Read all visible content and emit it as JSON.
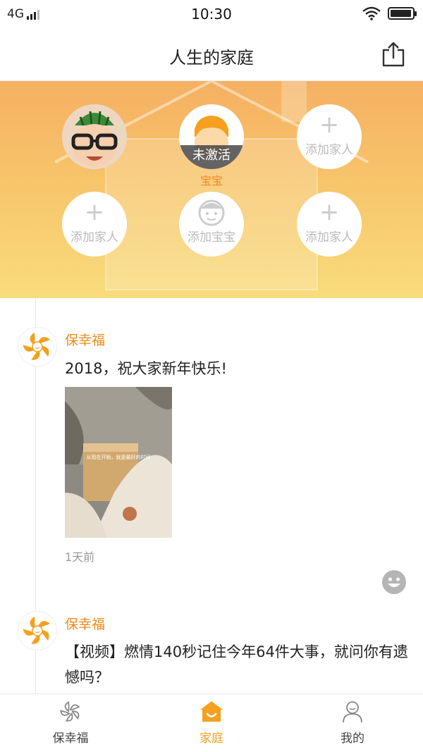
{
  "status_bar": {
    "network": "4G",
    "time": "10:30",
    "battery_level": 0.95
  },
  "nav": {
    "title": "人生的家庭",
    "share_icon": "share-icon"
  },
  "family": {
    "members": [
      {
        "name": "",
        "type": "photo",
        "icon": "baby-photo-avatar"
      },
      {
        "name": "宝宝",
        "type": "baby-inactive",
        "badge": "未激活",
        "icon": "baby-avatar-icon"
      },
      {
        "name": "",
        "type": "add",
        "plus": "+",
        "label": "添加家人",
        "icon": "plus-icon"
      },
      {
        "name": "",
        "type": "add",
        "plus": "+",
        "label": "添加家人",
        "icon": "plus-icon"
      },
      {
        "name": "",
        "type": "add-baby",
        "label": "添加宝宝",
        "icon": "baby-face-icon"
      },
      {
        "name": "",
        "type": "add",
        "plus": "+",
        "label": "添加家人",
        "icon": "plus-icon"
      }
    ]
  },
  "feed": {
    "posts": [
      {
        "author": "保幸福",
        "text": "2018，祝大家新年快乐!",
        "image_caption": "从现在开始，就是最好的时间",
        "time": "1天前"
      },
      {
        "author": "保幸福",
        "text": "【视频】燃情140秒记住今年64件大事，就问你有遗憾吗？"
      }
    ]
  },
  "tabs": [
    {
      "label": "保幸福",
      "icon": "pinwheel-icon",
      "active": false
    },
    {
      "label": "家庭",
      "icon": "home-icon",
      "active": true
    },
    {
      "label": "我的",
      "icon": "user-icon",
      "active": false
    }
  ],
  "colors": {
    "accent": "#f5a01e",
    "author": "#f08a1c",
    "header_top": "#f5b062",
    "header_bottom": "#f8dc7c"
  }
}
